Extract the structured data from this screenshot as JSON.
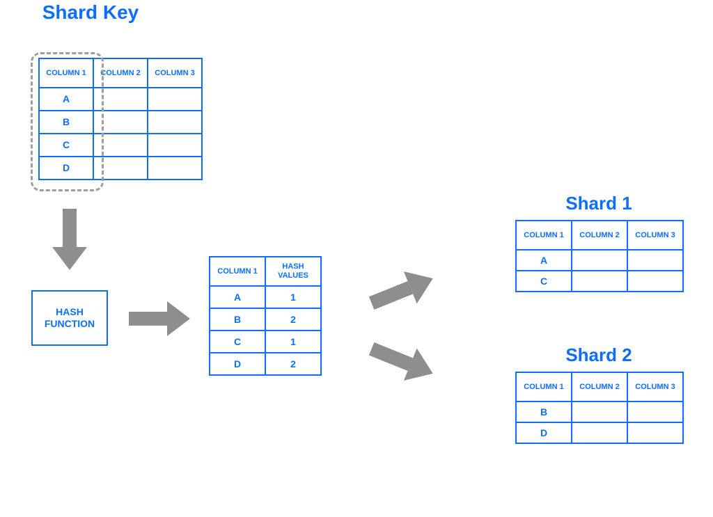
{
  "labels": {
    "shard_key_title": "Shard Key",
    "hash_function": "HASH FUNCTION",
    "shard1_title": "Shard 1",
    "shard2_title": "Shard 2"
  },
  "source_table": {
    "headers": [
      "COLUMN 1",
      "COLUMN 2",
      "COLUMN 3"
    ],
    "rows": [
      [
        "A",
        "",
        ""
      ],
      [
        "B",
        "",
        ""
      ],
      [
        "C",
        "",
        ""
      ],
      [
        "D",
        "",
        ""
      ]
    ]
  },
  "hash_table": {
    "headers": [
      "COLUMN 1",
      "HASH VALUES"
    ],
    "rows": [
      [
        "A",
        "1"
      ],
      [
        "B",
        "2"
      ],
      [
        "C",
        "1"
      ],
      [
        "D",
        "2"
      ]
    ]
  },
  "shard1": {
    "headers": [
      "COLUMN 1",
      "COLUMN 2",
      "COLUMN 3"
    ],
    "rows": [
      [
        "A",
        "",
        ""
      ],
      [
        "C",
        "",
        ""
      ]
    ]
  },
  "shard2": {
    "headers": [
      "COLUMN 1",
      "COLUMN 2",
      "COLUMN 3"
    ],
    "rows": [
      [
        "B",
        "",
        ""
      ],
      [
        "D",
        "",
        ""
      ]
    ]
  },
  "colors": {
    "blue": "#0d6efd",
    "arrow": "#8e8e8e",
    "dash": "#9e9e9e"
  }
}
